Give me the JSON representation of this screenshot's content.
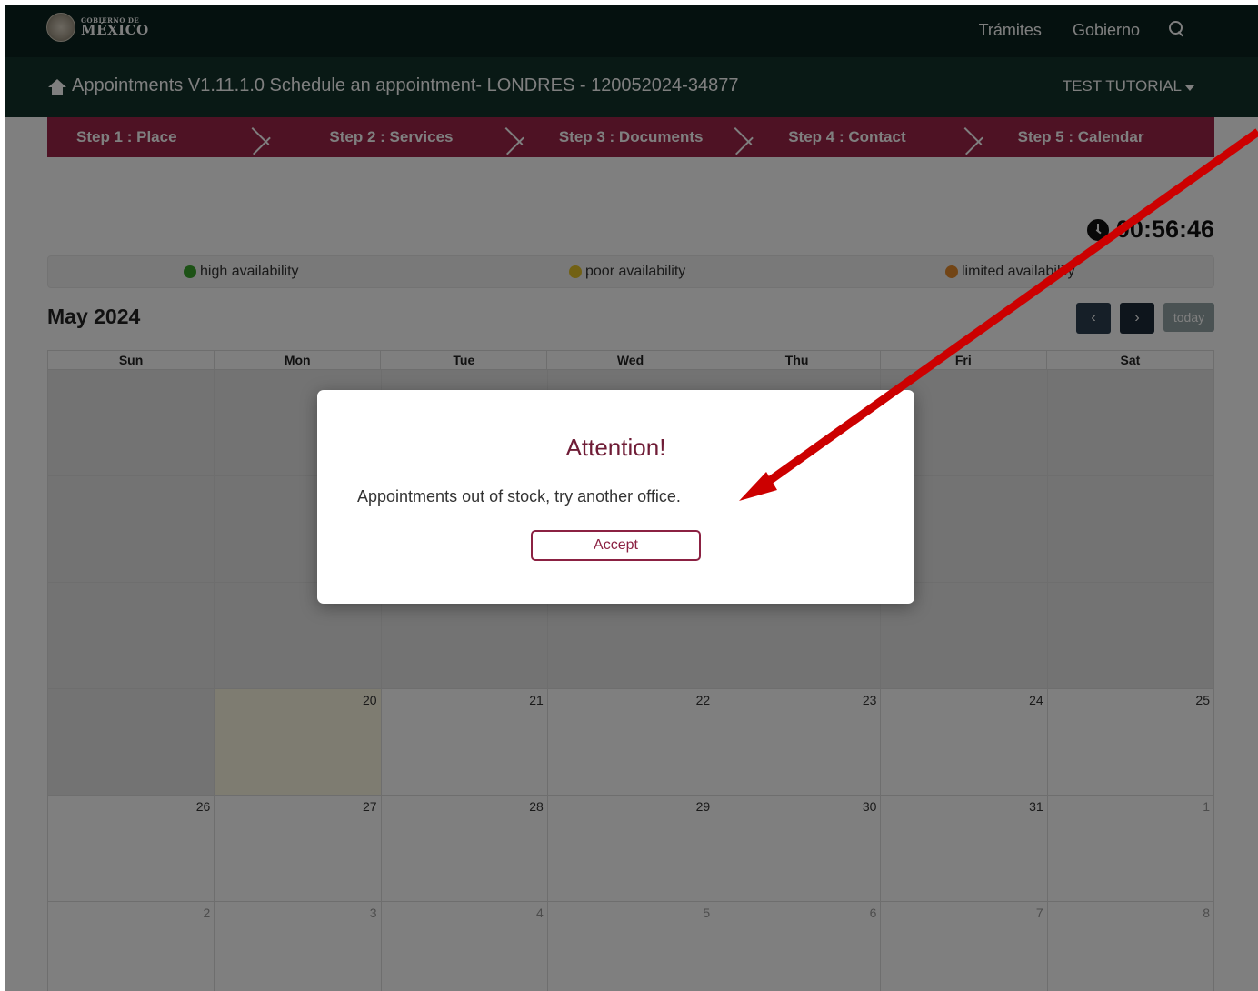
{
  "gov_bar": {
    "logo_small": "GOBIERNO DE",
    "logo_big": "MÉXICO",
    "links": [
      "Trámites",
      "Gobierno"
    ]
  },
  "app_bar": {
    "title": "Appointments V1.11.1.0  Schedule an appointment- LONDRES - 120052024-34877",
    "user": "TEST TUTORIAL"
  },
  "steps": [
    "Step 1 : Place",
    "Step 2 : Services",
    "Step 3 : Documents",
    "Step 4 : Contact",
    "Step 5 : Calendar"
  ],
  "timer": "00:56:46",
  "legend": [
    {
      "label": "high availability",
      "color": "#3aa42c"
    },
    {
      "label": "poor availability",
      "color": "#e5c228"
    },
    {
      "label": "limited availability",
      "color": "#e48a2c"
    }
  ],
  "calendar": {
    "title": "May 2024",
    "today_label": "today",
    "weekdays": [
      "Sun",
      "Mon",
      "Tue",
      "Wed",
      "Thu",
      "Fri",
      "Sat"
    ],
    "rows": [
      [
        "",
        "",
        "",
        "",
        "",
        "",
        ""
      ],
      [
        "",
        "",
        "",
        "",
        "",
        "",
        ""
      ],
      [
        "",
        "",
        "",
        "",
        "",
        "",
        ""
      ],
      [
        "",
        "20",
        "21",
        "22",
        "23",
        "24",
        "25"
      ],
      [
        "26",
        "27",
        "28",
        "29",
        "30",
        "31",
        "1"
      ],
      [
        "2",
        "3",
        "4",
        "5",
        "6",
        "7",
        "8"
      ]
    ]
  },
  "modal": {
    "title": "Attention!",
    "message": "Appointments out of stock, try another office.",
    "button": "Accept"
  },
  "colors": {
    "gov_bar": "#0b231e",
    "app_bar": "#13322b",
    "steps": "#9d2449",
    "modal_title": "#6f1c36",
    "annotation_arrow": "#cc0000"
  }
}
